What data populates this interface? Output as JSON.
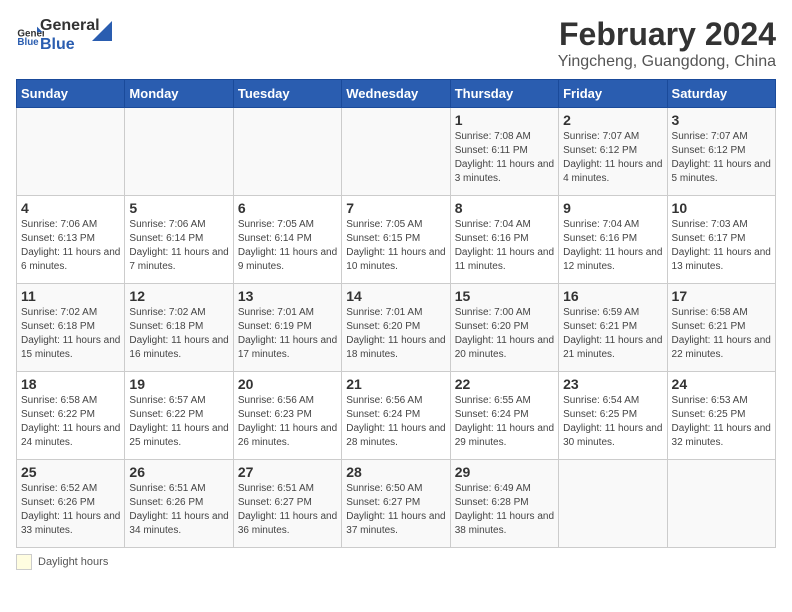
{
  "header": {
    "logo_general": "General",
    "logo_blue": "Blue",
    "month_year": "February 2024",
    "location": "Yingcheng, Guangdong, China"
  },
  "days_of_week": [
    "Sunday",
    "Monday",
    "Tuesday",
    "Wednesday",
    "Thursday",
    "Friday",
    "Saturday"
  ],
  "legend_label": "Daylight hours",
  "weeks": [
    [
      {
        "day": "",
        "info": ""
      },
      {
        "day": "",
        "info": ""
      },
      {
        "day": "",
        "info": ""
      },
      {
        "day": "",
        "info": ""
      },
      {
        "day": "1",
        "info": "Sunrise: 7:08 AM\nSunset: 6:11 PM\nDaylight: 11 hours and 3 minutes."
      },
      {
        "day": "2",
        "info": "Sunrise: 7:07 AM\nSunset: 6:12 PM\nDaylight: 11 hours and 4 minutes."
      },
      {
        "day": "3",
        "info": "Sunrise: 7:07 AM\nSunset: 6:12 PM\nDaylight: 11 hours and 5 minutes."
      }
    ],
    [
      {
        "day": "4",
        "info": "Sunrise: 7:06 AM\nSunset: 6:13 PM\nDaylight: 11 hours and 6 minutes."
      },
      {
        "day": "5",
        "info": "Sunrise: 7:06 AM\nSunset: 6:14 PM\nDaylight: 11 hours and 7 minutes."
      },
      {
        "day": "6",
        "info": "Sunrise: 7:05 AM\nSunset: 6:14 PM\nDaylight: 11 hours and 9 minutes."
      },
      {
        "day": "7",
        "info": "Sunrise: 7:05 AM\nSunset: 6:15 PM\nDaylight: 11 hours and 10 minutes."
      },
      {
        "day": "8",
        "info": "Sunrise: 7:04 AM\nSunset: 6:16 PM\nDaylight: 11 hours and 11 minutes."
      },
      {
        "day": "9",
        "info": "Sunrise: 7:04 AM\nSunset: 6:16 PM\nDaylight: 11 hours and 12 minutes."
      },
      {
        "day": "10",
        "info": "Sunrise: 7:03 AM\nSunset: 6:17 PM\nDaylight: 11 hours and 13 minutes."
      }
    ],
    [
      {
        "day": "11",
        "info": "Sunrise: 7:02 AM\nSunset: 6:18 PM\nDaylight: 11 hours and 15 minutes."
      },
      {
        "day": "12",
        "info": "Sunrise: 7:02 AM\nSunset: 6:18 PM\nDaylight: 11 hours and 16 minutes."
      },
      {
        "day": "13",
        "info": "Sunrise: 7:01 AM\nSunset: 6:19 PM\nDaylight: 11 hours and 17 minutes."
      },
      {
        "day": "14",
        "info": "Sunrise: 7:01 AM\nSunset: 6:20 PM\nDaylight: 11 hours and 18 minutes."
      },
      {
        "day": "15",
        "info": "Sunrise: 7:00 AM\nSunset: 6:20 PM\nDaylight: 11 hours and 20 minutes."
      },
      {
        "day": "16",
        "info": "Sunrise: 6:59 AM\nSunset: 6:21 PM\nDaylight: 11 hours and 21 minutes."
      },
      {
        "day": "17",
        "info": "Sunrise: 6:58 AM\nSunset: 6:21 PM\nDaylight: 11 hours and 22 minutes."
      }
    ],
    [
      {
        "day": "18",
        "info": "Sunrise: 6:58 AM\nSunset: 6:22 PM\nDaylight: 11 hours and 24 minutes."
      },
      {
        "day": "19",
        "info": "Sunrise: 6:57 AM\nSunset: 6:22 PM\nDaylight: 11 hours and 25 minutes."
      },
      {
        "day": "20",
        "info": "Sunrise: 6:56 AM\nSunset: 6:23 PM\nDaylight: 11 hours and 26 minutes."
      },
      {
        "day": "21",
        "info": "Sunrise: 6:56 AM\nSunset: 6:24 PM\nDaylight: 11 hours and 28 minutes."
      },
      {
        "day": "22",
        "info": "Sunrise: 6:55 AM\nSunset: 6:24 PM\nDaylight: 11 hours and 29 minutes."
      },
      {
        "day": "23",
        "info": "Sunrise: 6:54 AM\nSunset: 6:25 PM\nDaylight: 11 hours and 30 minutes."
      },
      {
        "day": "24",
        "info": "Sunrise: 6:53 AM\nSunset: 6:25 PM\nDaylight: 11 hours and 32 minutes."
      }
    ],
    [
      {
        "day": "25",
        "info": "Sunrise: 6:52 AM\nSunset: 6:26 PM\nDaylight: 11 hours and 33 minutes."
      },
      {
        "day": "26",
        "info": "Sunrise: 6:51 AM\nSunset: 6:26 PM\nDaylight: 11 hours and 34 minutes."
      },
      {
        "day": "27",
        "info": "Sunrise: 6:51 AM\nSunset: 6:27 PM\nDaylight: 11 hours and 36 minutes."
      },
      {
        "day": "28",
        "info": "Sunrise: 6:50 AM\nSunset: 6:27 PM\nDaylight: 11 hours and 37 minutes."
      },
      {
        "day": "29",
        "info": "Sunrise: 6:49 AM\nSunset: 6:28 PM\nDaylight: 11 hours and 38 minutes."
      },
      {
        "day": "",
        "info": ""
      },
      {
        "day": "",
        "info": ""
      }
    ]
  ]
}
